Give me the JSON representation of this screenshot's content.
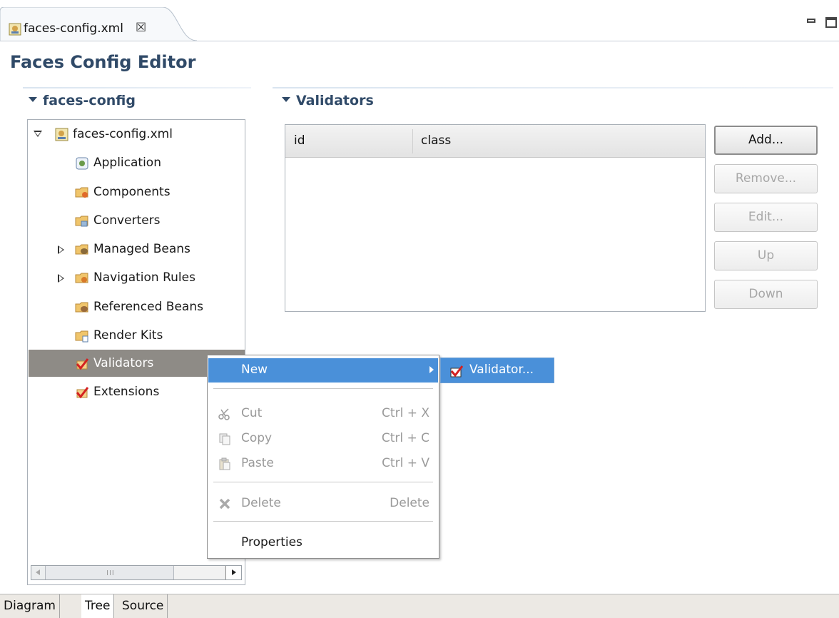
{
  "tab": {
    "label": "faces-config.xml",
    "close_glyph": "☒"
  },
  "editor": {
    "title": "Faces Config Editor"
  },
  "tree_section": {
    "title": "faces-config",
    "root_label": "faces-config.xml",
    "items": [
      {
        "label": "Application",
        "icon": "application-icon"
      },
      {
        "label": "Components",
        "icon": "components-folder-icon"
      },
      {
        "label": "Converters",
        "icon": "converters-folder-icon"
      },
      {
        "label": "Managed Beans",
        "icon": "managed-beans-folder-icon"
      },
      {
        "label": "Navigation Rules",
        "icon": "navigation-rules-folder-icon"
      },
      {
        "label": "Referenced Beans",
        "icon": "referenced-beans-folder-icon"
      },
      {
        "label": "Render Kits",
        "icon": "render-kits-folder-icon"
      },
      {
        "label": "Validators",
        "icon": "validators-check-icon",
        "selected": true
      },
      {
        "label": "Extensions",
        "icon": "extensions-check-icon"
      }
    ]
  },
  "validators_section": {
    "title": "Validators",
    "columns": [
      "id",
      "class"
    ],
    "rows": [],
    "buttons": {
      "add": "Add...",
      "remove": "Remove...",
      "edit": "Edit...",
      "up": "Up",
      "down": "Down"
    }
  },
  "context_menu": {
    "new": "New",
    "cut": {
      "label": "Cut",
      "shortcut": "Ctrl + X"
    },
    "copy": {
      "label": "Copy",
      "shortcut": "Ctrl + C"
    },
    "paste": {
      "label": "Paste",
      "shortcut": "Ctrl + V"
    },
    "delete": {
      "label": "Delete",
      "shortcut": "Delete"
    },
    "properties": "Properties"
  },
  "submenu": {
    "validator": "Validator..."
  },
  "bottom_tabs": [
    "Diagram",
    "Tree",
    "Source"
  ],
  "colors": {
    "title": "#304a68",
    "highlight": "#4a90d9",
    "selection": "#8e8b86"
  }
}
